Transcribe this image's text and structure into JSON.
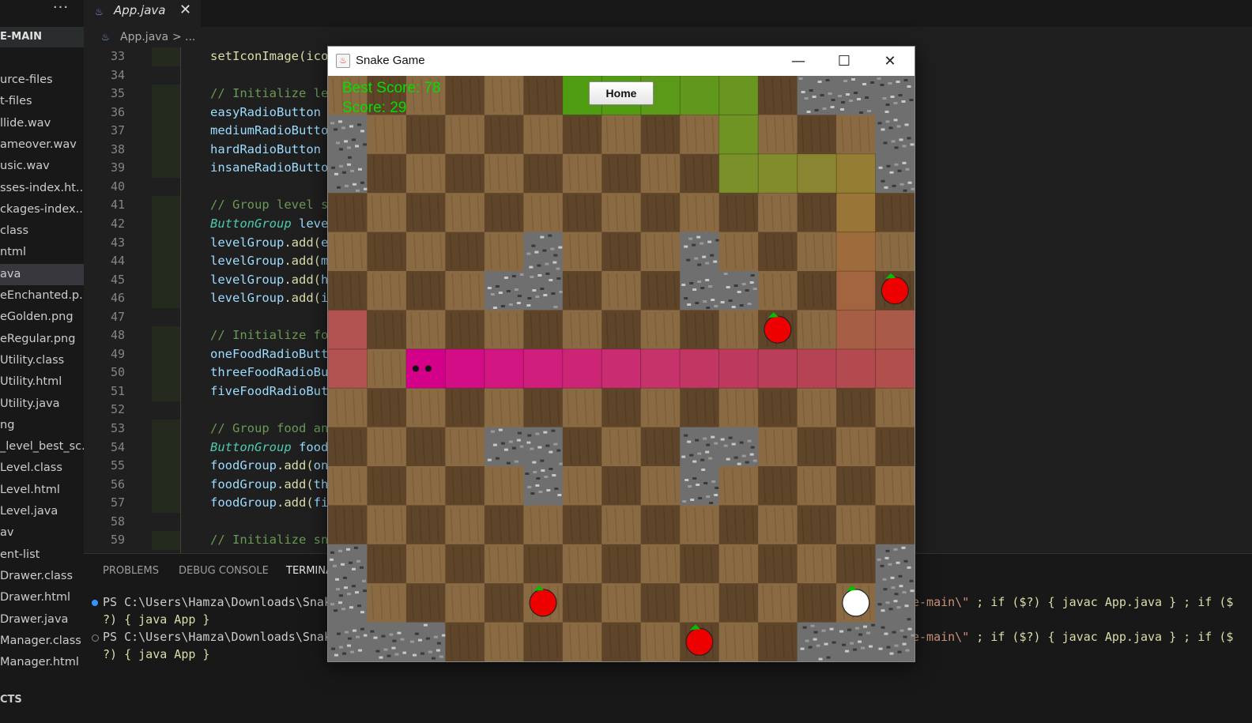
{
  "sidebar": {
    "more_label": "···",
    "section_title": "E-MAIN",
    "items": [
      "urce-files",
      "t-files",
      "llide.wav",
      "ameover.wav",
      "usic.wav",
      "sses-index.ht...",
      "ckages-index...",
      "class",
      "ntml",
      "ava",
      "eEnchanted.p...",
      "eGolden.png",
      "eRegular.png",
      "Utility.class",
      "Utility.html",
      "Utility.java",
      "ng",
      "_level_best_sc...",
      "Level.class",
      "Level.html",
      "Level.java",
      "av",
      "ent-list",
      "Drawer.class",
      "Drawer.html",
      "Drawer.java",
      "Manager.class",
      "Manager.html"
    ],
    "active_index": 9,
    "footer": "CTS"
  },
  "tabs": {
    "active": {
      "label": "App.java",
      "close": "✕",
      "icon": "java-file-icon"
    }
  },
  "breadcrumb": {
    "file": "App.java",
    "separator": ">",
    "more": "..."
  },
  "editor": {
    "lines": [
      {
        "num": "33",
        "parts": [
          {
            "t": "setIconImage(ico",
            "c": "fn"
          }
        ]
      },
      {
        "num": "34",
        "parts": []
      },
      {
        "num": "35",
        "parts": [
          {
            "t": "// Initialize le",
            "c": "cm"
          }
        ]
      },
      {
        "num": "36",
        "parts": [
          {
            "t": "easyRadioButton ",
            "c": "va"
          }
        ]
      },
      {
        "num": "37",
        "parts": [
          {
            "t": "mediumRadioButto",
            "c": "va"
          }
        ]
      },
      {
        "num": "38",
        "parts": [
          {
            "t": "hardRadioButton ",
            "c": "va"
          }
        ]
      },
      {
        "num": "39",
        "parts": [
          {
            "t": "insaneRadioButto",
            "c": "va"
          }
        ]
      },
      {
        "num": "40",
        "parts": []
      },
      {
        "num": "41",
        "parts": [
          {
            "t": "// Group level s",
            "c": "cm"
          }
        ]
      },
      {
        "num": "42",
        "parts": [
          {
            "t": "ButtonGroup",
            "c": "ty"
          },
          {
            "t": " leve",
            "c": "va"
          }
        ]
      },
      {
        "num": "43",
        "parts": [
          {
            "t": "levelGroup",
            "c": "va"
          },
          {
            "t": ".add(",
            "c": "fg"
          },
          {
            "t": "e",
            "c": "va"
          }
        ]
      },
      {
        "num": "44",
        "parts": [
          {
            "t": "levelGroup",
            "c": "va"
          },
          {
            "t": ".add(",
            "c": "fg"
          },
          {
            "t": "m",
            "c": "va"
          }
        ]
      },
      {
        "num": "45",
        "parts": [
          {
            "t": "levelGroup",
            "c": "va"
          },
          {
            "t": ".add(",
            "c": "fg"
          },
          {
            "t": "h",
            "c": "va"
          }
        ]
      },
      {
        "num": "46",
        "parts": [
          {
            "t": "levelGroup",
            "c": "va"
          },
          {
            "t": ".add(",
            "c": "fg"
          },
          {
            "t": "i",
            "c": "va"
          }
        ]
      },
      {
        "num": "47",
        "parts": []
      },
      {
        "num": "48",
        "parts": [
          {
            "t": "// Initialize fo",
            "c": "cm"
          }
        ]
      },
      {
        "num": "49",
        "parts": [
          {
            "t": "oneFoodRadioButt",
            "c": "va"
          }
        ]
      },
      {
        "num": "50",
        "parts": [
          {
            "t": "threeFoodRadioBu",
            "c": "va"
          }
        ]
      },
      {
        "num": "51",
        "parts": [
          {
            "t": "fiveFoodRadioBut",
            "c": "va"
          }
        ]
      },
      {
        "num": "52",
        "parts": []
      },
      {
        "num": "53",
        "parts": [
          {
            "t": "// Group food an",
            "c": "cm"
          }
        ]
      },
      {
        "num": "54",
        "parts": [
          {
            "t": "ButtonGroup",
            "c": "ty"
          },
          {
            "t": " food",
            "c": "va"
          }
        ]
      },
      {
        "num": "55",
        "parts": [
          {
            "t": "foodGroup",
            "c": "va"
          },
          {
            "t": ".add(",
            "c": "fg"
          },
          {
            "t": "on",
            "c": "va"
          }
        ]
      },
      {
        "num": "56",
        "parts": [
          {
            "t": "foodGroup",
            "c": "va"
          },
          {
            "t": ".add(",
            "c": "fg"
          },
          {
            "t": "th",
            "c": "va"
          }
        ]
      },
      {
        "num": "57",
        "parts": [
          {
            "t": "foodGroup",
            "c": "va"
          },
          {
            "t": ".add(",
            "c": "fg"
          },
          {
            "t": "fi",
            "c": "va"
          }
        ]
      },
      {
        "num": "58",
        "parts": []
      },
      {
        "num": "59",
        "parts": [
          {
            "t": "// Initialize sn",
            "c": "cm"
          }
        ]
      }
    ]
  },
  "panel": {
    "tabs": [
      "PROBLEMS",
      "DEBUG CONSOLE",
      "TERMINA"
    ],
    "active_tab": 2,
    "terminal": [
      {
        "prompt": "PS C:\\Users\\Hamza\\Downloads\\Snak",
        "tail_prefix": "e-main\\\"",
        "tail": " ; if ($?) { javac App.java } ; if ($",
        "cont": "?) { java App }",
        "dot": "filled"
      },
      {
        "prompt": "PS C:\\Users\\Hamza\\Downloads\\Snak",
        "tail_prefix": "e-main\\\"",
        "tail": " ; if ($?) { javac App.java } ; if ($",
        "cont": "?) { java App }",
        "dot": "hollow"
      }
    ]
  },
  "game": {
    "window_title": "Snake Game",
    "controls": {
      "minimize": "—",
      "maximize": "☐",
      "close": "✕"
    },
    "hud": {
      "best_score": "Best Score: 78",
      "score": "Score: 29"
    },
    "home_button": "Home",
    "grid": {
      "cols": 15,
      "rows": 15
    },
    "colors": {
      "dirt_light": "#8a6a42",
      "dirt_dark": "#5e4428",
      "stone": "#6f6f6f",
      "apple": "#ee0000",
      "apple_leaf": "#00c000",
      "golden": "#ffffff"
    },
    "stones": [
      [
        12,
        0
      ],
      [
        13,
        0
      ],
      [
        14,
        0
      ],
      [
        0,
        1
      ],
      [
        14,
        1
      ],
      [
        0,
        2
      ],
      [
        14,
        2
      ],
      [
        5,
        4
      ],
      [
        9,
        4
      ],
      [
        4,
        5
      ],
      [
        5,
        5
      ],
      [
        9,
        5
      ],
      [
        10,
        5
      ],
      [
        4,
        9
      ],
      [
        5,
        9
      ],
      [
        9,
        9
      ],
      [
        10,
        9
      ],
      [
        5,
        10
      ],
      [
        9,
        10
      ],
      [
        0,
        12
      ],
      [
        14,
        12
      ],
      [
        0,
        13
      ],
      [
        14,
        13
      ],
      [
        0,
        14
      ],
      [
        1,
        14
      ],
      [
        2,
        14
      ],
      [
        12,
        14
      ],
      [
        13,
        14
      ],
      [
        14,
        14
      ]
    ],
    "snake": [
      {
        "cell": [
          2,
          7
        ],
        "color": "#d4008a",
        "head": true
      },
      {
        "cell": [
          3,
          7
        ],
        "color": "#d30d85"
      },
      {
        "cell": [
          4,
          7
        ],
        "color": "#d11581"
      },
      {
        "cell": [
          5,
          7
        ],
        "color": "#cf1e7c"
      },
      {
        "cell": [
          6,
          7
        ],
        "color": "#cc2576"
      },
      {
        "cell": [
          7,
          7
        ],
        "color": "#c92c70"
      },
      {
        "cell": [
          8,
          7
        ],
        "color": "#c6336a"
      },
      {
        "cell": [
          9,
          7
        ],
        "color": "#c23664"
      },
      {
        "cell": [
          10,
          7
        ],
        "color": "#bd3a5e"
      },
      {
        "cell": [
          11,
          7
        ],
        "color": "#b93e58"
      },
      {
        "cell": [
          12,
          7
        ],
        "color": "#b54354"
      },
      {
        "cell": [
          13,
          7
        ],
        "color": "#b24a50"
      },
      {
        "cell": [
          14,
          7
        ],
        "color": "#b04f4c"
      },
      {
        "cell": [
          0,
          7
        ],
        "color": "#b25352"
      },
      {
        "cell": [
          0,
          6
        ],
        "color": "#b25352"
      },
      {
        "cell": [
          14,
          6
        ],
        "color": "#aa5a48"
      },
      {
        "cell": [
          13,
          6
        ],
        "color": "#a65f44"
      },
      {
        "cell": [
          13,
          5
        ],
        "color": "#a26540"
      },
      {
        "cell": [
          13,
          4
        ],
        "color": "#9e6c3c"
      },
      {
        "cell": [
          13,
          3
        ],
        "color": "#997538"
      },
      {
        "cell": [
          13,
          2
        ],
        "color": "#947e34"
      },
      {
        "cell": [
          12,
          2
        ],
        "color": "#8a8530"
      },
      {
        "cell": [
          11,
          2
        ],
        "color": "#818c2c"
      },
      {
        "cell": [
          10,
          2
        ],
        "color": "#799128"
      },
      {
        "cell": [
          10,
          1
        ],
        "color": "#709424"
      },
      {
        "cell": [
          10,
          0
        ],
        "color": "#689620"
      },
      {
        "cell": [
          9,
          0
        ],
        "color": "#60981c"
      },
      {
        "cell": [
          8,
          0
        ],
        "color": "#5a9a18"
      },
      {
        "cell": [
          7,
          0
        ],
        "color": "#549b14"
      },
      {
        "cell": [
          6,
          0
        ],
        "color": "#509c12"
      }
    ],
    "apples": [
      {
        "cell": [
          14,
          5
        ],
        "golden": false
      },
      {
        "cell": [
          11,
          6
        ],
        "golden": false
      },
      {
        "cell": [
          5,
          13
        ],
        "golden": false
      },
      {
        "cell": [
          13,
          13
        ],
        "golden": true
      },
      {
        "cell": [
          9,
          14
        ],
        "golden": false
      }
    ]
  }
}
